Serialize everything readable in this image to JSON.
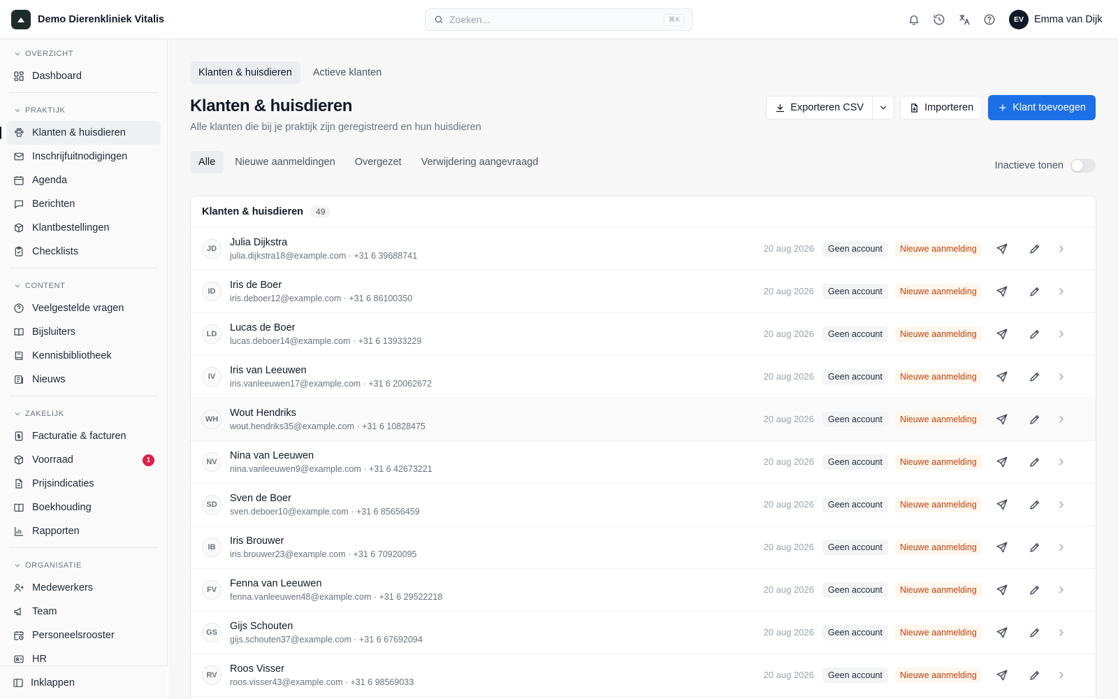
{
  "app": {
    "brand_name": "Demo Dierenkliniek Vitalis"
  },
  "search": {
    "placeholder": "Zoeken...",
    "shortcut": "⌘K"
  },
  "user": {
    "initials": "EV",
    "name": "Emma van Dijk"
  },
  "top_icons": [
    "bell-icon",
    "history-icon",
    "translate-icon",
    "help-icon"
  ],
  "sidebar": {
    "sections": [
      {
        "title": "OVERZICHT",
        "items": [
          {
            "label": "Dashboard",
            "icon": "dashboard-icon"
          }
        ]
      },
      {
        "title": "PRAKTIJK",
        "items": [
          {
            "label": "Klanten & huisdieren",
            "icon": "paw-icon",
            "active": true
          },
          {
            "label": "Inschrijfuitnodigingen",
            "icon": "mail-icon"
          },
          {
            "label": "Agenda",
            "icon": "calendar-icon"
          },
          {
            "label": "Berichten",
            "icon": "message-icon"
          },
          {
            "label": "Klantbestellingen",
            "icon": "package-icon"
          },
          {
            "label": "Checklists",
            "icon": "clipboard-icon"
          }
        ]
      },
      {
        "title": "CONTENT",
        "items": [
          {
            "label": "Veelgestelde vragen",
            "icon": "help-circle-icon"
          },
          {
            "label": "Bijsluiters",
            "icon": "book-open-icon"
          },
          {
            "label": "Kennisbibliotheek",
            "icon": "book-icon"
          },
          {
            "label": "Nieuws",
            "icon": "newspaper-icon"
          }
        ]
      },
      {
        "title": "ZAKELIJK",
        "items": [
          {
            "label": "Facturatie & facturen",
            "icon": "invoice-icon"
          },
          {
            "label": "Voorraad",
            "icon": "box-icon",
            "badge": "1"
          },
          {
            "label": "Prijsindicaties",
            "icon": "file-icon"
          },
          {
            "label": "Boekhouding",
            "icon": "ledger-icon"
          },
          {
            "label": "Rapporten",
            "icon": "bar-chart-icon"
          }
        ]
      },
      {
        "title": "ORGANISATIE",
        "items": [
          {
            "label": "Medewerkers",
            "icon": "users-icon"
          },
          {
            "label": "Team",
            "icon": "megaphone-icon"
          },
          {
            "label": "Personeelsrooster",
            "icon": "calendar-clock-icon"
          },
          {
            "label": "HR",
            "icon": "id-card-icon"
          }
        ]
      }
    ],
    "collapse_label": "Inklappen"
  },
  "main": {
    "tabs": [
      {
        "label": "Klanten & huisdieren",
        "active": true
      },
      {
        "label": "Actieve klanten"
      }
    ],
    "title": "Klanten & huisdieren",
    "subtitle": "Alle klanten die bij je praktijk zijn geregistreerd en hun huisdieren",
    "export_label": "Exporteren CSV",
    "import_label": "Importeren",
    "add_label": "Klant toevoegen",
    "filters": [
      {
        "label": "Alle",
        "active": true
      },
      {
        "label": "Nieuwe aanmeldingen"
      },
      {
        "label": "Overgezet"
      },
      {
        "label": "Verwijdering aangevraagd"
      }
    ],
    "toggle_label": "Inactieve tonen",
    "toggle_on": false,
    "list": {
      "title": "Klanten & huisdieren",
      "count": "49",
      "rows": [
        {
          "initials": "JD",
          "name": "Julia Dijkstra",
          "contact": "julia.dijkstra18@example.com · +31 6 39688741",
          "date": "20 aug 2026",
          "account": "Geen account",
          "status": "Nieuwe aanmelding"
        },
        {
          "initials": "ID",
          "name": "Iris de Boer",
          "contact": "iris.deboer12@example.com · +31 6 86100350",
          "date": "20 aug 2026",
          "account": "Geen account",
          "status": "Nieuwe aanmelding"
        },
        {
          "initials": "LD",
          "name": "Lucas de Boer",
          "contact": "lucas.deboer14@example.com · +31 6 13933229",
          "date": "20 aug 2026",
          "account": "Geen account",
          "status": "Nieuwe aanmelding"
        },
        {
          "initials": "IV",
          "name": "Iris van Leeuwen",
          "contact": "iris.vanleeuwen17@example.com · +31 6 20062672",
          "date": "20 aug 2026",
          "account": "Geen account",
          "status": "Nieuwe aanmelding"
        },
        {
          "initials": "WH",
          "name": "Wout Hendriks",
          "contact": "wout.hendriks35@example.com · +31 6 10828475",
          "date": "20 aug 2026",
          "account": "Geen account",
          "status": "Nieuwe aanmelding"
        },
        {
          "initials": "NV",
          "name": "Nina van Leeuwen",
          "contact": "nina.vanleeuwen9@example.com · +31 6 42673221",
          "date": "20 aug 2026",
          "account": "Geen account",
          "status": "Nieuwe aanmelding"
        },
        {
          "initials": "SD",
          "name": "Sven de Boer",
          "contact": "sven.deboer10@example.com · +31 6 85656459",
          "date": "20 aug 2026",
          "account": "Geen account",
          "status": "Nieuwe aanmelding"
        },
        {
          "initials": "IB",
          "name": "Iris Brouwer",
          "contact": "iris.brouwer23@example.com · +31 6 70920095",
          "date": "20 aug 2026",
          "account": "Geen account",
          "status": "Nieuwe aanmelding"
        },
        {
          "initials": "FV",
          "name": "Fenna van Leeuwen",
          "contact": "fenna.vanleeuwen48@example.com · +31 6 29522218",
          "date": "20 aug 2026",
          "account": "Geen account",
          "status": "Nieuwe aanmelding"
        },
        {
          "initials": "GS",
          "name": "Gijs Schouten",
          "contact": "gijs.schouten37@example.com · +31 6 67692094",
          "date": "20 aug 2026",
          "account": "Geen account",
          "status": "Nieuwe aanmelding"
        },
        {
          "initials": "RV",
          "name": "Roos Visser",
          "contact": "roos.visser43@example.com · +31 6 98569033",
          "date": "20 aug 2026",
          "account": "Geen account",
          "status": "Nieuwe aanmelding"
        }
      ]
    }
  },
  "colors": {
    "primary": "#1d6fe8",
    "status_text": "#c2410c",
    "status_bg": "#fff7ed",
    "badge": "#e11d48"
  }
}
